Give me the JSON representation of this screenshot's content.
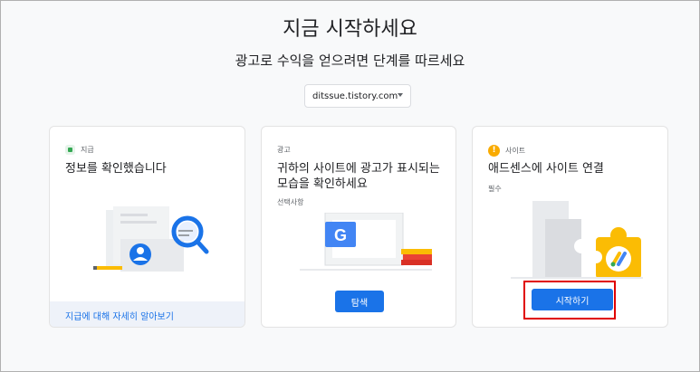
{
  "page": {
    "title": "지금 시작하세요",
    "subtitle": "광고로 수익을 얻으려면 단계를 따르세요"
  },
  "site_selector": {
    "value": "ditssue.tistory.com"
  },
  "cards": [
    {
      "tag": "지급",
      "tag_icon": "green-square-icon",
      "title": "정보를 확인했습니다",
      "link": "지급에 대해 자세히 알아보기"
    },
    {
      "tag": "광고",
      "title": "귀하의 사이트에 광고가 표시되는 모습을 확인하세요",
      "note": "선택사항",
      "button": "탐색"
    },
    {
      "tag": "사이트",
      "tag_icon": "warning-icon",
      "title": "애드센스에 사이트 연결",
      "note": "필수",
      "button": "시작하기"
    }
  ],
  "colors": {
    "accent": "#1a73e8",
    "warning": "#f9ab00",
    "success": "#34a853",
    "highlight": "#e00000"
  }
}
